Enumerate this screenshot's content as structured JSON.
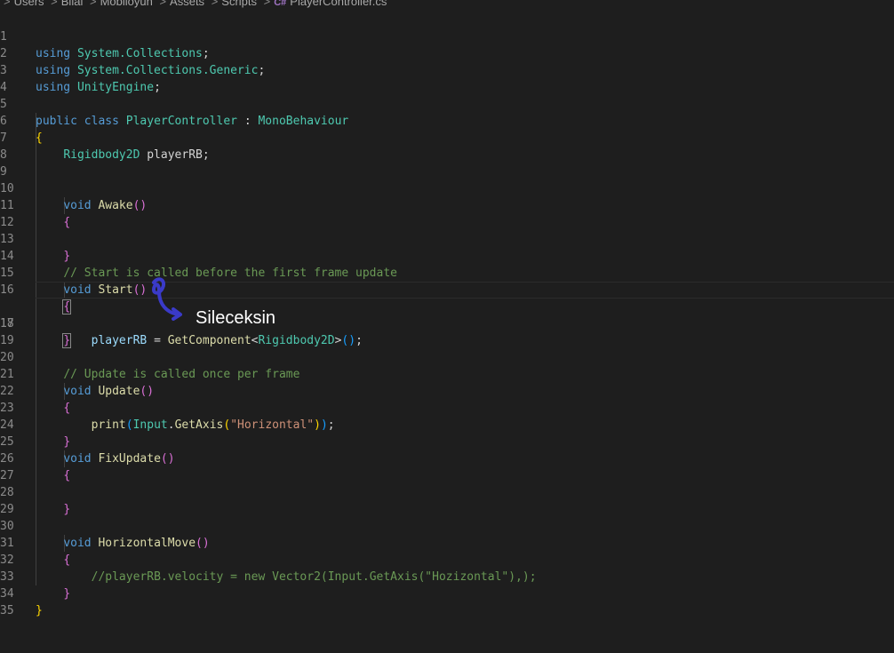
{
  "breadcrumb": {
    "items": [
      "Users",
      "Bilal",
      "Mobiloyun",
      "Assets",
      "Scripts"
    ],
    "file_icon": "C#",
    "file": "PlayerController.cs"
  },
  "line_numbers": [
    "1",
    "2",
    "3",
    "4",
    "5",
    "6",
    "7",
    "8",
    "9",
    "10",
    "11",
    "12",
    "13",
    "14",
    "15",
    "16",
    "17",
    "18",
    "19",
    "20",
    "21",
    "22",
    "23",
    "24",
    "25",
    "26",
    "27",
    "28",
    "29",
    "30",
    "31",
    "32",
    "33",
    "34",
    "35"
  ],
  "code": {
    "l1_kw": "using",
    "l1_ns": "System.Collections",
    "l2_kw": "using",
    "l2_ns": "System.Collections.Generic",
    "l3_kw": "using",
    "l3_ns": "UnityEngine",
    "l5_public": "public",
    "l5_class": "class",
    "l5_name": "PlayerController",
    "l5_colon": " : ",
    "l5_base": "MonoBehaviour",
    "l6_brace": "{",
    "l7_type": "Rigidbody2D",
    "l7_var": " playerRB;",
    "l10_kw": "void",
    "l10_fn": "Awake",
    "l11_brace": "{",
    "l13_brace": "}",
    "l14_comment": "// Start is called before the first frame update",
    "l15_kw": "void",
    "l15_fn": "Start",
    "l16_brace": "{",
    "l17_var": "playerRB",
    "l17_eq": " = ",
    "l17_fn": "GetComponent",
    "l17_lt": "<",
    "l17_type": "Rigidbody2D",
    "l17_gt": ">",
    "l17_end": ";",
    "l18_brace": "}",
    "l20_comment": "// Update is called once per frame",
    "l21_kw": "void",
    "l21_fn": "Update",
    "l22_brace": "{",
    "l23_fn": "print",
    "l23_obj": "Input",
    "l23_method": "GetAxis",
    "l23_str": "\"Horizontal\"",
    "l23_end": ";",
    "l24_brace": "}",
    "l25_kw": "void",
    "l25_fn": "FixUpdate",
    "l26_brace": "{",
    "l28_brace": "}",
    "l30_kw": "void",
    "l30_fn": "HorizontalMove",
    "l31_brace": "{",
    "l32_comment": "//playerRB.velocity = new Vector2(Input.GetAxis(\"Hozizontal\"),);",
    "l33_brace": "}",
    "l34_brace": "}"
  },
  "annotation": {
    "text": "Sileceksin",
    "color": "#3a3ac8"
  }
}
